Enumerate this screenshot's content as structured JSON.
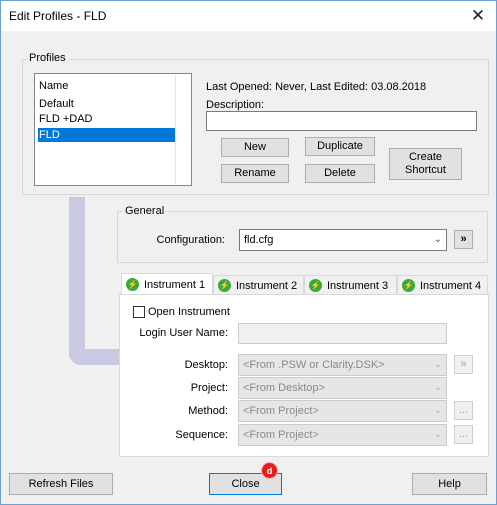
{
  "window": {
    "title": "Edit Profiles - FLD",
    "close_glyph": "✕"
  },
  "profiles": {
    "group_title": "Profiles",
    "list_header": "Name",
    "items": [
      "Default",
      "FLD +DAD",
      "FLD"
    ],
    "selected": "FLD",
    "info_text": "Last Opened: Never, Last Edited: 03.08.2018",
    "description_label": "Description:",
    "description_value": "",
    "buttons": {
      "new": "New",
      "duplicate": "Duplicate",
      "rename": "Rename",
      "delete": "Delete",
      "create_shortcut": "Create Shortcut"
    }
  },
  "general": {
    "group_title": "General",
    "configuration_label": "Configuration:",
    "configuration_value": "fld.cfg",
    "browse_glyph": "»"
  },
  "instruments": {
    "tabs": [
      {
        "label": "Instrument 1",
        "active": true
      },
      {
        "label": "Instrument 2",
        "active": false
      },
      {
        "label": "Instrument 3",
        "active": false
      },
      {
        "label": "Instrument 4",
        "active": false
      }
    ],
    "open_instrument_label": "Open Instrument",
    "open_instrument_checked": false,
    "login_user_label": "Login User Name:",
    "login_user_value": "",
    "desktop_label": "Desktop:",
    "desktop_value": "<From .PSW or Clarity.DSK>",
    "project_label": "Project:",
    "project_value": "<From Desktop>",
    "method_label": "Method:",
    "method_value": "<From Project>",
    "sequence_label": "Sequence:",
    "sequence_value": "<From Project>",
    "browse_glyph": "»",
    "ellipsis_glyph": "..."
  },
  "footer": {
    "refresh": "Refresh Files",
    "close": "Close",
    "help": "Help",
    "badge": "d"
  },
  "colors": {
    "selection": "#0078d7",
    "connector": "#c9c9e4",
    "tab_icon": "#3aa93a",
    "badge": "#e02020"
  },
  "icons": {
    "close": "close-icon",
    "tab_instrument": "green-lightning-circle-icon",
    "dropdown": "chevron-down-icon",
    "browse": "double-chevron-right-icon"
  }
}
